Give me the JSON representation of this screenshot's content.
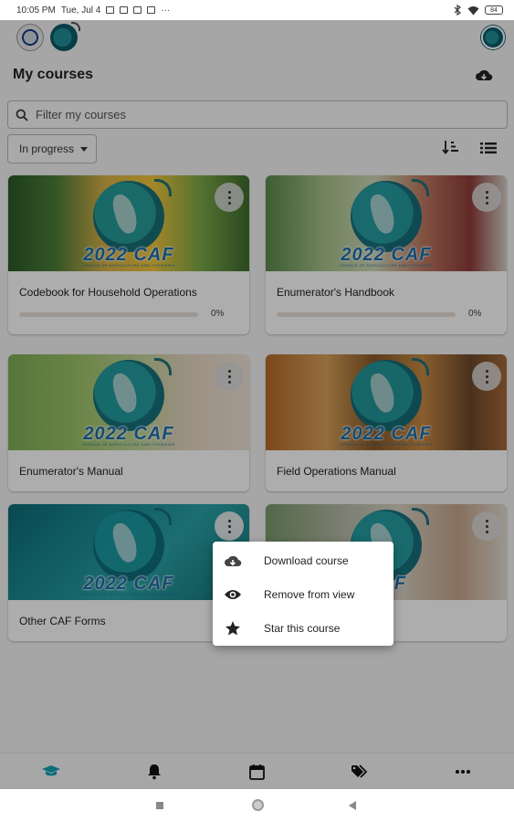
{
  "status_bar": {
    "time": "10:05 PM",
    "date": "Tue, Jul 4",
    "extra": "···",
    "battery": "84"
  },
  "header": {
    "title": "My courses",
    "cloud_icon": "cloud-download-icon"
  },
  "filter": {
    "placeholder": "Filter my courses",
    "value": ""
  },
  "status_select": {
    "selected": "In progress"
  },
  "courses": [
    {
      "title": "Codebook for Household Operations",
      "progress": "0%",
      "progress_value": 0,
      "banner": "2022 CAF",
      "banner_sub": "CENSUS OF AGRICULTURE AND FISHERIES"
    },
    {
      "title": "Enumerator's Handbook",
      "progress": "0%",
      "progress_value": 0,
      "banner": "2022 CAF",
      "banner_sub": "CENSUS OF AGRICULTURE AND FISHERIES"
    },
    {
      "title": "Enumerator's Manual",
      "banner": "2022 CAF",
      "banner_sub": "CENSUS OF AGRICULTURE AND FISHERIES"
    },
    {
      "title": "Field Operations Manual",
      "banner": "2022 CAF",
      "banner_sub": "CENSUS OF AGRICULTURE AND FISHERIES"
    },
    {
      "title": "Other CAF Forms",
      "banner": "2022 CAF",
      "banner_sub": "CENSUS OF AGRICULTURE AND FISHERIES"
    },
    {
      "title": "",
      "banner": "CAF",
      "banner_sub": ""
    }
  ],
  "context_menu": {
    "items": [
      {
        "label": "Download course",
        "icon": "cloud-download-icon"
      },
      {
        "label": "Remove from view",
        "icon": "eye-icon"
      },
      {
        "label": "Star this course",
        "icon": "star-icon"
      }
    ]
  },
  "bottom_nav": {
    "items": [
      "graduation-cap-icon",
      "bell-icon",
      "calendar-icon",
      "tags-icon",
      "more-horizontal-icon"
    ]
  },
  "colors": {
    "accent": "#11a3b5",
    "progress_fill": "#d86a1c",
    "scrim": "rgba(0,0,0,0.32)"
  }
}
